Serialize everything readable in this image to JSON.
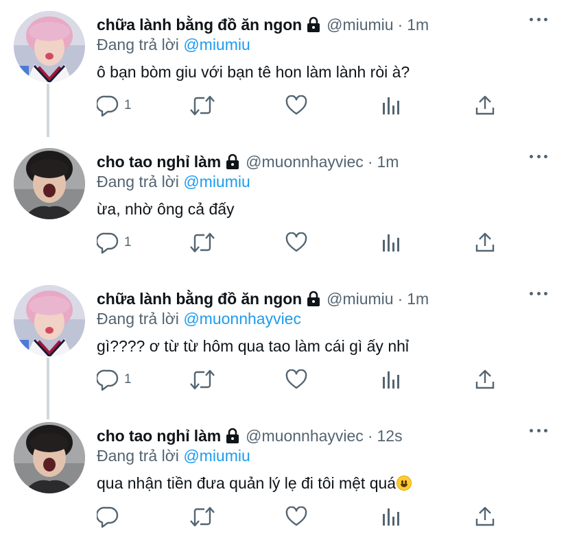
{
  "replying_label": "Đang trả lời",
  "colors": {
    "accent": "#1d9bf0",
    "muted": "#536471",
    "text": "#0f1419",
    "thread": "#cfd9de"
  },
  "icons": {
    "more": "more-dots-icon",
    "lock": "lock-icon",
    "reply": "reply-icon",
    "retweet": "retweet-icon",
    "like": "heart-icon",
    "stats": "stats-icon",
    "share": "share-icon"
  },
  "tweets": [
    {
      "name": "chữa lành bằng đồ ăn ngon",
      "handle": "@miumiu",
      "dot": "·",
      "time": "1m",
      "reply_to": "@miumiu",
      "text": "ô bạn bòm giu với bạn tê hon làm lành ròi à?",
      "reply_count": "1",
      "avatar": "pink-hair-avatar"
    },
    {
      "name": "cho tao nghỉ làm",
      "handle": "@muonnhayviec",
      "dot": "·",
      "time": "1m",
      "reply_to": "@miumiu",
      "text": "ừa, nhờ ông cả đấy",
      "reply_count": "1",
      "avatar": "dark-hair-avatar"
    },
    {
      "name": "chữa lành bằng đồ ăn ngon",
      "handle": "@miumiu",
      "dot": "·",
      "time": "1m",
      "reply_to": "@muonnhayviec",
      "text": "gì???? ơ từ từ hôm qua tao làm cái gì ấy nhỉ",
      "reply_count": "1",
      "avatar": "pink-hair-avatar"
    },
    {
      "name": "cho tao nghỉ làm",
      "handle": "@muonnhayviec",
      "dot": "·",
      "time": "12s",
      "reply_to": "@miumiu",
      "text": "qua nhận tiền đưa quản lý lẹ đi tôi mệt quá",
      "reply_count": "",
      "avatar": "dark-hair-avatar"
    }
  ]
}
